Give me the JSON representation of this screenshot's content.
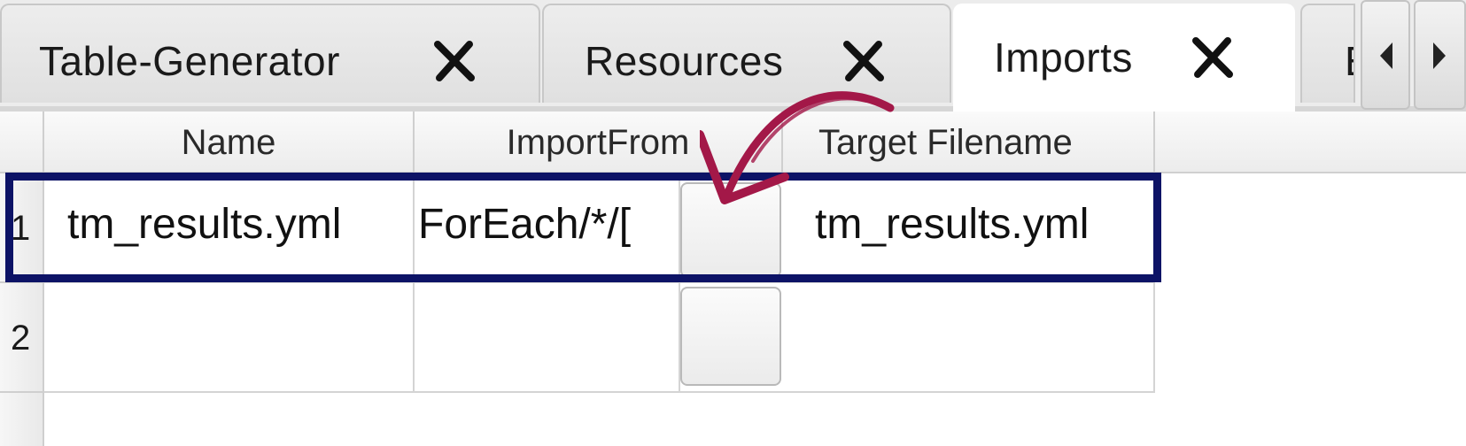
{
  "tabs": [
    {
      "label": "Table-Generator",
      "active": false
    },
    {
      "label": "Resources",
      "active": false
    },
    {
      "label": "Imports",
      "active": true
    }
  ],
  "partial_tab": {
    "label": "E"
  },
  "tab_scroll": {
    "left_icon": "triangle-left-icon",
    "right_icon": "triangle-right-icon"
  },
  "table": {
    "columns": [
      "Name",
      "ImportFrom",
      "Target Filename"
    ],
    "rows": [
      {
        "number": "1",
        "name": "tm_results.yml",
        "import_from": "ForEach/*/[",
        "target_filename": "tm_results.yml"
      },
      {
        "number": "2",
        "name": "",
        "import_from": "",
        "target_filename": ""
      }
    ]
  },
  "annotation": {
    "highlight_color": "#0d1366",
    "arrow_color": "#a31848"
  }
}
